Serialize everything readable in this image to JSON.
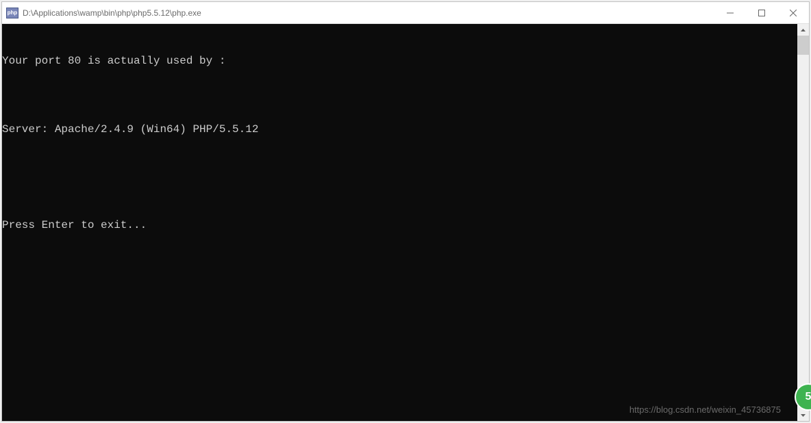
{
  "titlebar": {
    "icon_text": "php",
    "title": "D:\\Applications\\wamp\\bin\\php\\php5.5.12\\php.exe"
  },
  "console": {
    "lines": [
      "Your port 80 is actually used by :",
      "",
      "Server: Apache/2.4.9 (Win64) PHP/5.5.12",
      "",
      "",
      "Press Enter to exit..."
    ]
  },
  "watermark": "https://blog.csdn.net/weixin_45736875",
  "green_badge": "5"
}
